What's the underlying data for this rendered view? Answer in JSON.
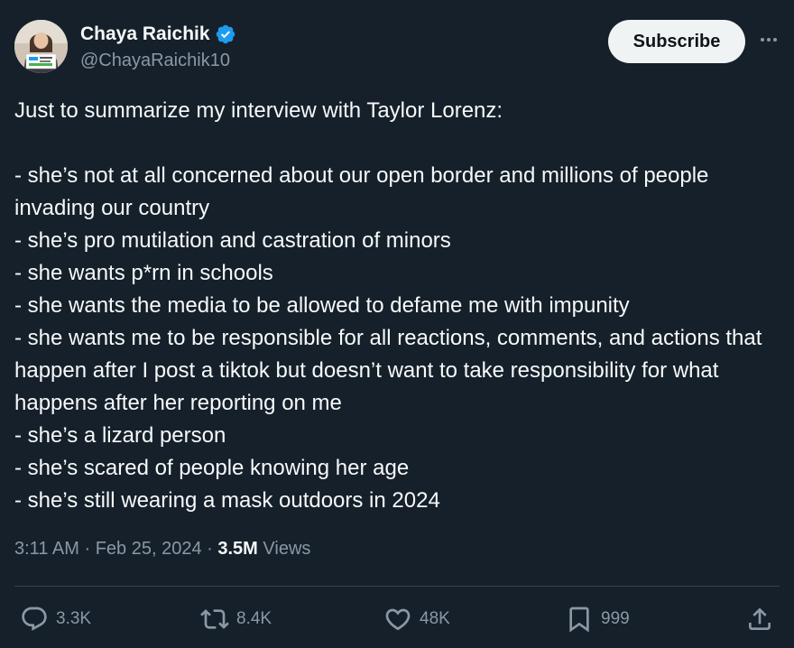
{
  "author": {
    "display_name": "Chaya Raichik",
    "handle": "@ChayaRaichik10",
    "avatar_icon": "profile-photo",
    "verified_icon": "verified-badge-icon"
  },
  "header": {
    "subscribe_label": "Subscribe",
    "more_icon": "more-horizontal-icon"
  },
  "tweet": {
    "intro": "Just to summarize my interview with Taylor Lorenz:",
    "lines": [
      "- she’s not at all concerned about our open border and millions of people invading our country",
      "- she’s pro mutilation and castration of minors",
      "- she wants p*rn in schools",
      "- she wants the media to be allowed to defame me with impunity",
      "- she wants me to be responsible for all reactions, comments, and actions that happen after I post a tiktok but doesn’t want to take responsibility for what happens after her reporting on me",
      "- she’s a lizard person",
      "- she’s scared of people knowing her age",
      "- she’s still wearing a mask outdoors in 2024"
    ]
  },
  "meta": {
    "time": "3:11 AM",
    "separator": "·",
    "date": "Feb 25, 2024",
    "views_count": "3.5M",
    "views_label": "Views"
  },
  "actions": {
    "replies": "3.3K",
    "reposts": "8.4K",
    "likes": "48K",
    "bookmarks": "999"
  },
  "colors": {
    "background": "#15202b",
    "text": "#f7f9f9",
    "secondary": "#8b98a5",
    "verified": "#1d9bf0",
    "button_bg": "#eff3f4"
  }
}
